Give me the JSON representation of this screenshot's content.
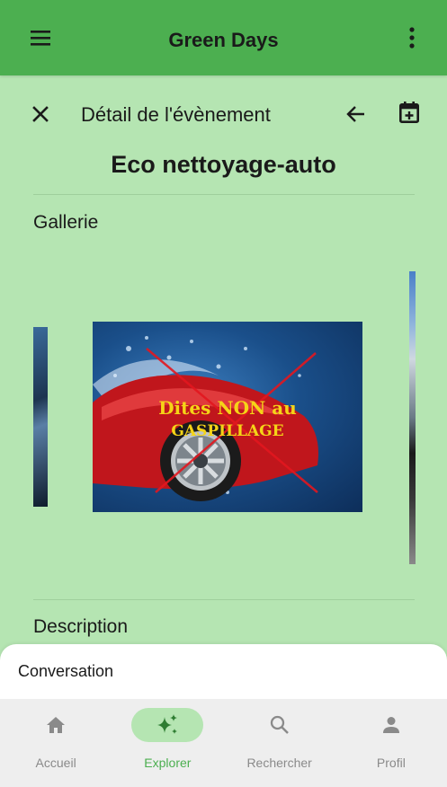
{
  "app": {
    "title": "Green Days"
  },
  "detail": {
    "heading": "Détail de l'évènement",
    "event_title": "Eco nettoyage-auto"
  },
  "gallery": {
    "label": "Gallerie",
    "main_image_text_line1": "Dites NON au",
    "main_image_text_line2": "GASPILLAGE"
  },
  "description": {
    "label": "Description"
  },
  "sheet": {
    "title": "Conversation"
  },
  "nav": {
    "items": [
      {
        "label": "Accueil",
        "icon": "home-icon"
      },
      {
        "label": "Explorer",
        "icon": "sparkle-icon"
      },
      {
        "label": "Rechercher",
        "icon": "search-icon"
      },
      {
        "label": "Profil",
        "icon": "person-icon"
      }
    ]
  },
  "colors": {
    "app_bar": "#4caf50",
    "background": "#b5e5b2",
    "nav_active": "#4caf50",
    "nav_inactive": "#8a8a8a"
  }
}
